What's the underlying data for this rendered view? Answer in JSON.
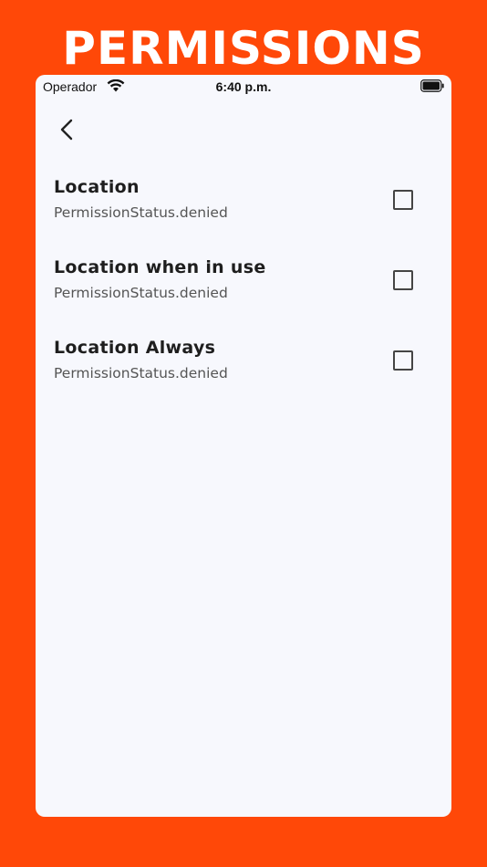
{
  "banner": {
    "title": "PERMISSIONS"
  },
  "status_bar": {
    "carrier": "Operador",
    "time": "6:40 p.m."
  },
  "nav": {
    "back_icon": "chevron-left-icon"
  },
  "permissions": [
    {
      "title": "Location",
      "status": "PermissionStatus.denied",
      "checked": false
    },
    {
      "title": "Location when in use",
      "status": "PermissionStatus.denied",
      "checked": false
    },
    {
      "title": "Location Always",
      "status": "PermissionStatus.denied",
      "checked": false
    }
  ],
  "colors": {
    "background": "#FF4808",
    "screen": "#F7F8FD",
    "text": "#1E1E1E"
  }
}
